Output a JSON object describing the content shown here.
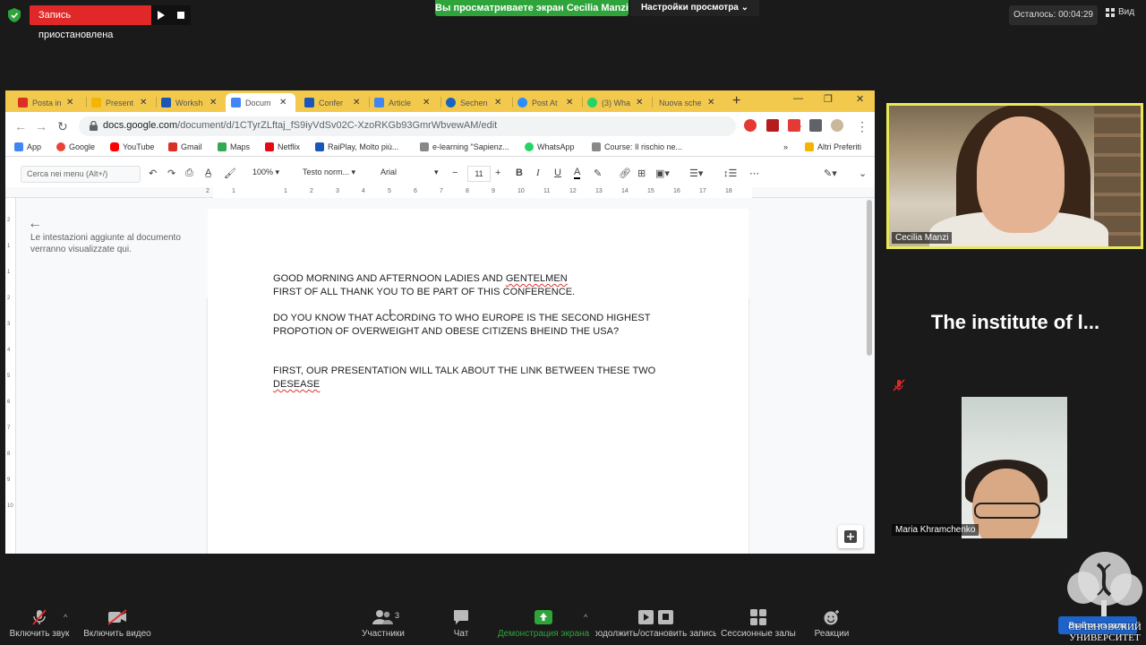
{
  "zoom_top": {
    "recording_status": "Запись приостановлена",
    "share_banner": "Вы просматриваете экран Cecilia Manzi",
    "view_settings": "Настройки просмотра",
    "timer": "Осталось: 00:04:29",
    "view_label": "Вид"
  },
  "browser": {
    "tabs": [
      {
        "label": "Posta in",
        "color": "#d93025"
      },
      {
        "label": "Present",
        "color": "#f4b400"
      },
      {
        "label": "Worksh",
        "color": "#1a56b8"
      },
      {
        "label": "Docum",
        "color": "#4285f4"
      },
      {
        "label": "Confer",
        "color": "#1a56b8"
      },
      {
        "label": "Article",
        "color": "#4285f4"
      },
      {
        "label": "Sechen",
        "color": "#1565c0"
      },
      {
        "label": "Post At",
        "color": "#2d8cff"
      },
      {
        "label": "(3) Wha",
        "color": "#25d366"
      },
      {
        "label": "Nuova sche",
        "color": "#f4b400"
      }
    ],
    "url_host": "docs.google.com",
    "url_path": "/document/d/1CTyrZLftaj_fS9iyVdSv02C-XzoRKGb93GmrWbvewAM/edit",
    "bookmarks": [
      {
        "label": "App",
        "color": "#4285f4"
      },
      {
        "label": "Google",
        "color": "#ea4335"
      },
      {
        "label": "YouTube",
        "color": "#ff0000"
      },
      {
        "label": "Gmail",
        "color": "#d93025"
      },
      {
        "label": "Maps",
        "color": "#34a853"
      },
      {
        "label": "Netflix",
        "color": "#e50914"
      },
      {
        "label": "RaiPlay, Molto più...",
        "color": "#1a56b8"
      },
      {
        "label": "e-learning \"Sapienz...",
        "color": "#888888"
      },
      {
        "label": "WhatsApp",
        "color": "#25d366"
      },
      {
        "label": "Course: Il rischio ne...",
        "color": "#888888"
      }
    ],
    "bookmarks_more": "»",
    "other_bookmarks": "Altri Preferiti"
  },
  "docs_toolbar": {
    "menu_search": "Cerca nei menu (Alt+/)",
    "zoom": "100%",
    "style": "Testo norm...",
    "font": "Arial",
    "font_size": "11",
    "bold": "B",
    "italic": "I",
    "underline": "U",
    "color": "A"
  },
  "ruler_numbers": [
    "2",
    "1",
    "1",
    "2",
    "3",
    "4",
    "5",
    "6",
    "7",
    "8",
    "9",
    "10",
    "11",
    "12",
    "13",
    "14",
    "15",
    "16",
    "17",
    "18"
  ],
  "vruler_numbers": [
    "2",
    "1",
    "1",
    "2",
    "3",
    "4",
    "5",
    "6",
    "7",
    "8",
    "9",
    "10"
  ],
  "outline": {
    "note": "Le intestazioni aggiunte al documento verranno visualizzate qui."
  },
  "document": {
    "lines": [
      {
        "pre": "GOOD MORNING AND AFTERNOON LADIES AND ",
        "err": "GENTELMEN"
      },
      {
        "pre": "FIRST OF ALL THANK YOU TO BE PART OF THIS CONFERENCE.",
        "err": ""
      },
      {
        "pre": "DO YOU KNOW THAT ACCORDING TO WHO EUROPE IS THE SECOND HIGHEST",
        "err": ""
      },
      {
        "pre": "PROPOTION OF OVERWEIGHT AND OBESE CITIZENS BHEIND THE USA?",
        "err": ""
      },
      {
        "pre": "FIRST, OUR PRESENTATION WILL TALK ABOUT THE LINK BETWEEN THESE TWO",
        "err": ""
      },
      {
        "pre": "",
        "err": "DESEASE"
      }
    ]
  },
  "participants": {
    "video1_name": "Cecilia Manzi",
    "video2_title": "The institute of l...",
    "video3_name": "Maria Khramchenko"
  },
  "zoom_bottom": {
    "mute": "Включить звук",
    "video": "Включить видео",
    "participants": "Участники",
    "participants_count": "3",
    "chat": "Чат",
    "share": "Демонстрация экрана",
    "record": "Продолжить/остановить запись",
    "breakout": "Сессионные залы",
    "reactions": "Реакции",
    "leave": "Выйти из зала"
  },
  "university": {
    "line1": "СЕЧЕНОВСКИЙ",
    "line2": "УНИВЕРСИТЕТ"
  }
}
